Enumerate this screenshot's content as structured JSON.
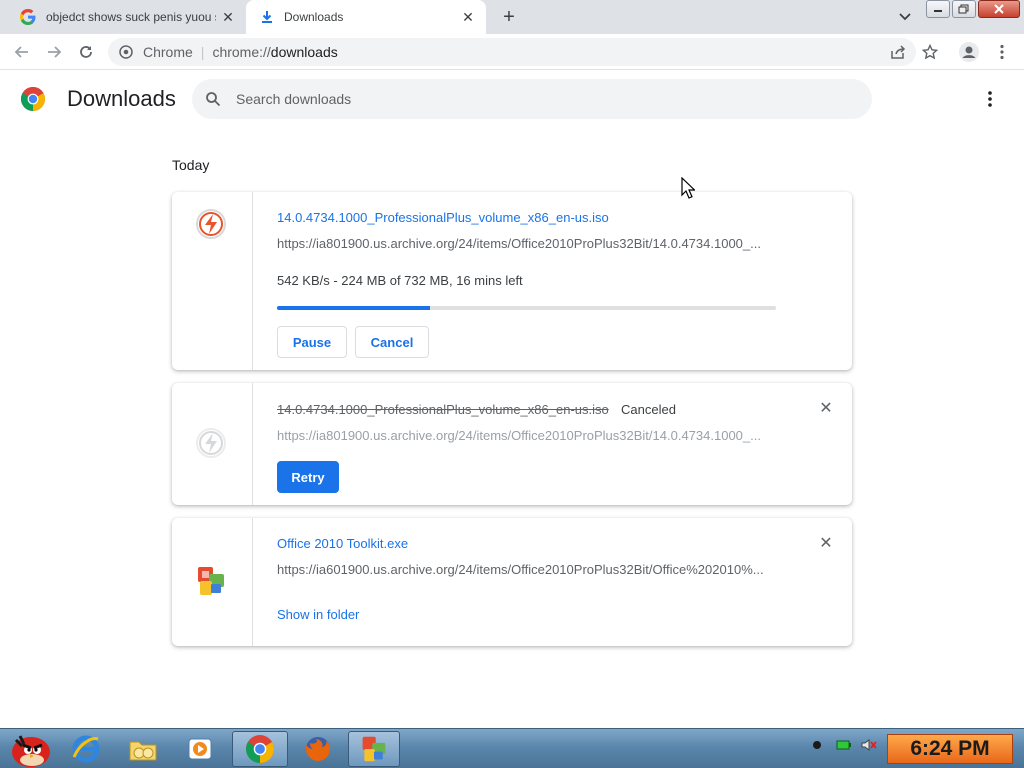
{
  "browser": {
    "tabs": [
      {
        "title": "objedct shows suck penis yuou s",
        "active": false
      },
      {
        "title": "Downloads",
        "active": true
      }
    ],
    "omnibox": {
      "site_label": "Chrome",
      "scheme": "chrome://",
      "path": "downloads"
    }
  },
  "page": {
    "title": "Downloads",
    "search_placeholder": "Search downloads",
    "section_label": "Today"
  },
  "downloads": [
    {
      "filename": "14.0.4734.1000_ProfessionalPlus_volume_x86_en-us.iso",
      "url": "https://ia801900.us.archive.org/24/items/Office2010ProPlus32Bit/14.0.4734.1000_...",
      "progress_text": "542 KB/s - 224 MB of 732 MB, 16 mins left",
      "progress_fraction": 0.306,
      "pause_label": "Pause",
      "cancel_label": "Cancel",
      "icon": "lightning-file-icon"
    },
    {
      "filename": "14.0.4734.1000_ProfessionalPlus_volume_x86_en-us.iso",
      "status": "Canceled",
      "url": "https://ia801900.us.archive.org/24/items/Office2010ProPlus32Bit/14.0.4734.1000_...",
      "retry_label": "Retry",
      "icon": "lightning-file-icon"
    },
    {
      "filename": "Office 2010 Toolkit.exe",
      "url": "https://ia601900.us.archive.org/24/items/Office2010ProPlus32Bit/Office%202010%...",
      "show_in_folder_label": "Show in folder",
      "icon": "office-toolkit-icon"
    }
  ],
  "taskbar": {
    "clock": "6:24 PM",
    "items": [
      "angry-bird-start-icon",
      "internet-explorer-icon",
      "folder-icon",
      "media-player-icon",
      "chrome-icon",
      "firefox-icon",
      "office-toolkit-icon"
    ]
  },
  "colors": {
    "accent": "#1a73e8",
    "tabstrip": "#dee1e6",
    "clock_bg": "#f28c28"
  }
}
